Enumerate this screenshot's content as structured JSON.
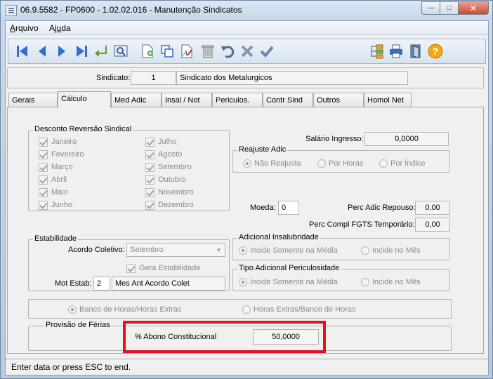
{
  "window": {
    "title": "06.9.5582 - FP0600 - 1.02.02.016 - Manutenção Sindicatos",
    "minimize": "—",
    "maximize": "□",
    "close": "✕"
  },
  "menu": [
    {
      "prefix": "",
      "underline": "A",
      "rest": "rquivo"
    },
    {
      "prefix": "Aj",
      "underline": "u",
      "rest": "da"
    }
  ],
  "toolbar": {
    "icons": [
      "first-icon",
      "prev-icon",
      "next-icon",
      "last-icon",
      "go-to-icon",
      "search-icon",
      "new-icon",
      "copy-icon",
      "edit-icon",
      "delete-icon",
      "undo-icon",
      "cancel-icon",
      "confirm-icon",
      "tree-icon",
      "print-icon",
      "exit-icon",
      "help-icon"
    ],
    "help_glyph": "?"
  },
  "header": {
    "sindicato_label": "Sindicato:",
    "sindicato_code": "1",
    "sindicato_name": "Sindicato dos Metalurgicos"
  },
  "tabs": [
    "Gerais",
    "Cálculo",
    "Med Adic",
    "Insal / Not",
    "Periculos.",
    "Contr Sind",
    "Outros",
    "Homol Net"
  ],
  "calculo": {
    "desconto_title": "Desconto Reversão Sindical",
    "months_left": [
      "Janeiro",
      "Fevereiro",
      "Março",
      "Abril",
      "Maio",
      "Junho"
    ],
    "months_right": [
      "Julho",
      "Agosto",
      "Setembro",
      "Outubro",
      "Novembro",
      "Dezembro"
    ],
    "salario_ingresso_label": "Salário Ingresso:",
    "salario_ingresso_value": "0,0000",
    "reajuste_title": "Reajuste Adic",
    "reajuste_options": [
      "Não Reajusta",
      "Por Horas",
      "Por Índice"
    ],
    "moeda_label": "Moeda:",
    "moeda_value": "0",
    "perc_adic_repouso_label": "Perc Adic Repouso:",
    "perc_adic_repouso_value": "0,00",
    "perc_fgts_label": "Perc Compl FGTS Temporário:",
    "perc_fgts_value": "0,00",
    "estabilidade_title": "Estabilidade",
    "acordo_label": "Acordo Coletivo:",
    "acordo_value": "Setembro",
    "gera_estabilidade_label": "Gera Estabilidade",
    "mot_estab_label": "Mot Estab:",
    "mot_estab_code": "2",
    "mot_estab_desc": "Mes Ant Acordo Colet",
    "insalubridade_title": "Adicional Insalubridade",
    "insalubridade_options": [
      "Incide Somente na Média",
      "Incide no Mês"
    ],
    "periculosidade_title": "Tipo Adicional Periculosidade",
    "periculosidade_options": [
      "Incide Somente na Média",
      "Incide no Mês"
    ],
    "banco_options": [
      "Banco de Horas/Horas Extras",
      "Horas Extras/Banco de Horas"
    ],
    "ferias_title": "Provisão de Férias",
    "abono_label": "% Abono Constitucional",
    "abono_value": "50,0000"
  },
  "status": {
    "text": "Enter data or press ESC to end."
  }
}
